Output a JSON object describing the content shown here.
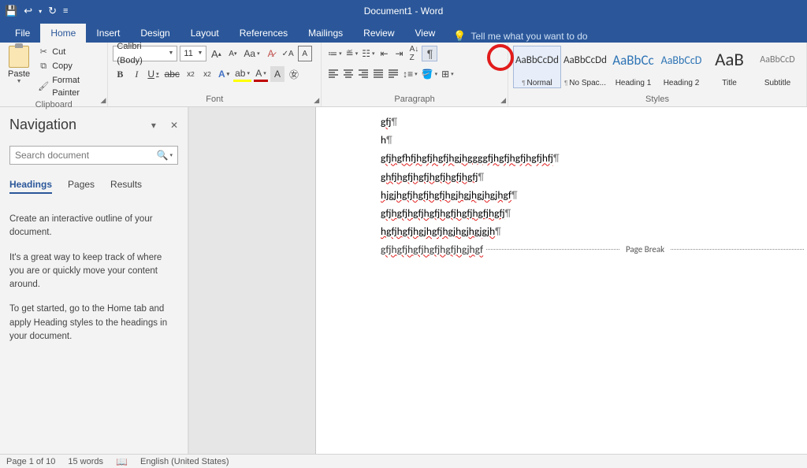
{
  "titlebar": {
    "title": "Document1  -  Word"
  },
  "tabs": {
    "file": "File",
    "home": "Home",
    "insert": "Insert",
    "design": "Design",
    "layout": "Layout",
    "references": "References",
    "mailings": "Mailings",
    "review": "Review",
    "view": "View",
    "tellme": "Tell me what you want to do"
  },
  "ribbon": {
    "clipboard": {
      "label": "Clipboard",
      "paste": "Paste",
      "cut": "Cut",
      "copy": "Copy",
      "format_painter": "Format Painter"
    },
    "font": {
      "label": "Font",
      "name": "Calibri (Body)",
      "size": "11"
    },
    "paragraph": {
      "label": "Paragraph"
    },
    "styles": {
      "label": "Styles",
      "items": [
        {
          "preview": "AaBbCcDd",
          "name": "Normal",
          "cls": "style-normal",
          "sel": true,
          "pilcrow": true
        },
        {
          "preview": "AaBbCcDd",
          "name": "No Spac...",
          "cls": "style-nospace",
          "pilcrow": true
        },
        {
          "preview": "AaBbCc",
          "name": "Heading 1",
          "cls": "style-h1"
        },
        {
          "preview": "AaBbCcD",
          "name": "Heading 2",
          "cls": "style-h2"
        },
        {
          "preview": "AaB",
          "name": "Title",
          "cls": "style-title"
        },
        {
          "preview": "AaBbCcD",
          "name": "Subtitle",
          "cls": "style-sub"
        }
      ]
    }
  },
  "nav": {
    "title": "Navigation",
    "search_placeholder": "Search document",
    "tabs": {
      "headings": "Headings",
      "pages": "Pages",
      "results": "Results"
    },
    "help1": "Create an interactive outline of your document.",
    "help2": "It's a great way to keep track of where you are or quickly move your content around.",
    "help3": "To get started, go to the Home tab and apply Heading styles to the headings in your document."
  },
  "document": {
    "lines": [
      "gfj",
      "h",
      "gfjhgfhfjhgfjhgfjhgjhggggfjhgfjhgfjhgfjhfj",
      "ghfjhgfjhgfjhgfjhgfjhgfj",
      "hjgjhgfjhgfjhgfjhgjhgjhgjhgjhgf",
      "gfjhgfjhgfjhgfjhgfjhgfjhgfjhgfj",
      "hgfjhgfjhgjhgfjhgjhgjhgjgjh",
      "gfjhgfjhgfjhgfjhgfjhgjhgf"
    ],
    "page_break": "Page Break"
  },
  "status": {
    "page": "Page 1 of 10",
    "words": "15 words",
    "lang": "English (United States)"
  }
}
